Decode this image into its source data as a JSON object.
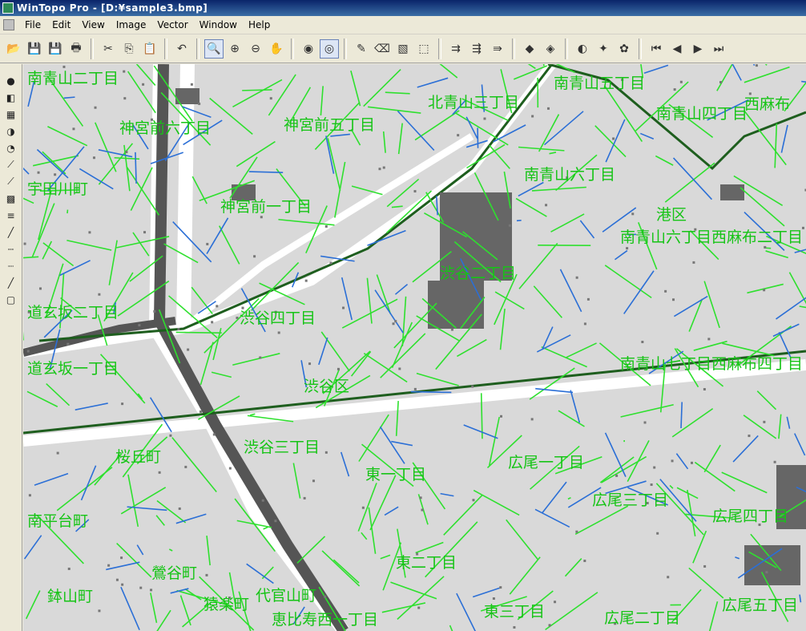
{
  "window": {
    "title": "WinTopo Pro - [D:¥sample3.bmp]"
  },
  "menu": [
    "File",
    "Edit",
    "View",
    "Image",
    "Vector",
    "Window",
    "Help"
  ],
  "toolbar": {
    "groups": [
      [
        "open-icon",
        "save-icon",
        "save-as-icon",
        "print-icon"
      ],
      [
        "cut-icon",
        "copy-icon",
        "paste-icon"
      ],
      [
        "undo-icon"
      ],
      [
        "zoom-icon",
        "zoom-in-icon",
        "zoom-out-icon",
        "pan-hand-icon"
      ],
      [
        "view-image-icon",
        "view-vector-icon"
      ],
      [
        "pencil-icon",
        "eraser-icon",
        "hatch-icon",
        "crop-icon"
      ],
      [
        "extract-1-icon",
        "extract-2-icon",
        "extract-3-icon"
      ],
      [
        "vectorize-red-icon",
        "vectorize-yellow-icon"
      ],
      [
        "vector-edit-icon",
        "vector-tool-icon",
        "vector-smooth-icon"
      ],
      [
        "first-icon",
        "prev-icon",
        "next-icon",
        "last-icon"
      ]
    ],
    "glyphs": {
      "open-icon": "📂",
      "save-icon": "💾",
      "save-as-icon": "💾",
      "print-icon": "🖶",
      "cut-icon": "✂",
      "copy-icon": "⎘",
      "paste-icon": "📋",
      "undo-icon": "↶",
      "zoom-icon": "🔍",
      "zoom-in-icon": "⊕",
      "zoom-out-icon": "⊖",
      "pan-hand-icon": "✋",
      "view-image-icon": "◉",
      "view-vector-icon": "◎",
      "pencil-icon": "✎",
      "eraser-icon": "⌫",
      "hatch-icon": "▧",
      "crop-icon": "⬚",
      "extract-1-icon": "⇉",
      "extract-2-icon": "⇶",
      "extract-3-icon": "⇛",
      "vectorize-red-icon": "◆",
      "vectorize-yellow-icon": "◈",
      "vector-edit-icon": "◐",
      "vector-tool-icon": "✦",
      "vector-smooth-icon": "✿",
      "first-icon": "⏮",
      "prev-icon": "◀",
      "next-icon": "▶",
      "last-icon": "⏭"
    },
    "pressed": [
      "zoom-icon",
      "view-vector-icon"
    ]
  },
  "left_tools": [
    {
      "name": "fill-tool-icon",
      "glyph": "●"
    },
    {
      "name": "color-select-icon",
      "glyph": "◧"
    },
    {
      "name": "threshold-icon",
      "glyph": "▦"
    },
    {
      "name": "contrast-icon",
      "glyph": "◑"
    },
    {
      "name": "dither-icon",
      "glyph": "◔"
    },
    {
      "name": "line-tool-icon",
      "glyph": "⟋"
    },
    {
      "name": "polyline-icon",
      "glyph": "⟋"
    },
    {
      "name": "palette-icon",
      "glyph": "▩"
    },
    {
      "name": "color-bars-icon",
      "glyph": "≡"
    },
    {
      "name": "brush-icon",
      "glyph": "╱"
    },
    {
      "name": "dash-line-icon",
      "glyph": "┄"
    },
    {
      "name": "dotted-line-icon",
      "glyph": "┈"
    },
    {
      "name": "straight-line-icon",
      "glyph": "╱"
    },
    {
      "name": "rectangle-icon",
      "glyph": "▢"
    }
  ],
  "map_labels": [
    "南青山二丁目",
    "神宮前六丁目",
    "北青山三丁目",
    "南青山五丁目",
    "神宮前五丁目",
    "南青山四丁目",
    "西麻布",
    "宇田川町",
    "南青山六丁目",
    "神宮前一丁目",
    "港区",
    "南青山六丁目西麻布二丁目",
    "渋谷四丁目",
    "道玄坂二丁目",
    "渋谷二丁目",
    "道玄坂一丁目",
    "南青山七丁目西麻布四丁目",
    "渋谷区",
    "桜丘町",
    "渋谷三丁目",
    "東一丁目",
    "広尾一丁目",
    "広尾三丁目",
    "広尾四丁目",
    "南平台町",
    "鶯谷町",
    "東二丁目",
    "鉢山町",
    "猿楽町",
    "代官山町",
    "恵比寿西一丁目",
    "東三丁目",
    "広尾二丁目",
    "広尾五丁目"
  ]
}
